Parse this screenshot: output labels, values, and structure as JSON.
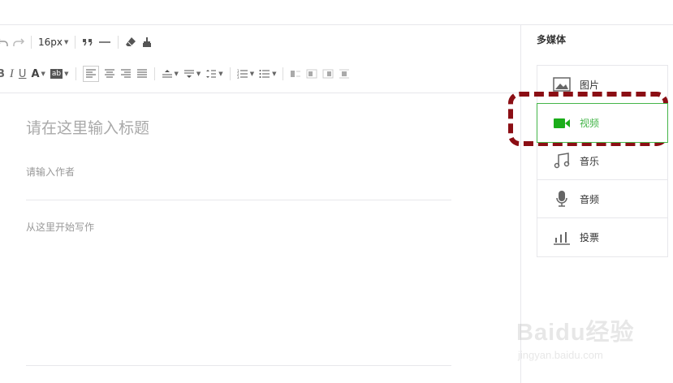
{
  "toolbar": {
    "font_size": "16px"
  },
  "editor": {
    "title_placeholder": "请在这里输入标题",
    "author_placeholder": "请输入作者",
    "body_placeholder": "从这里开始写作"
  },
  "sidebar": {
    "title": "多媒体",
    "items": [
      {
        "label": "图片",
        "icon": "image-icon",
        "active": false
      },
      {
        "label": "视频",
        "icon": "video-camera-icon",
        "active": true
      },
      {
        "label": "音乐",
        "icon": "music-note-icon",
        "active": false
      },
      {
        "label": "音频",
        "icon": "microphone-icon",
        "active": false
      },
      {
        "label": "投票",
        "icon": "bar-chart-icon",
        "active": false
      }
    ]
  },
  "watermark": {
    "main": "Baidu经验",
    "sub": "jingyan.baidu.com"
  },
  "colors": {
    "accent": "#44b549",
    "highlight": "#8b0e14",
    "border": "#e7e7eb"
  }
}
